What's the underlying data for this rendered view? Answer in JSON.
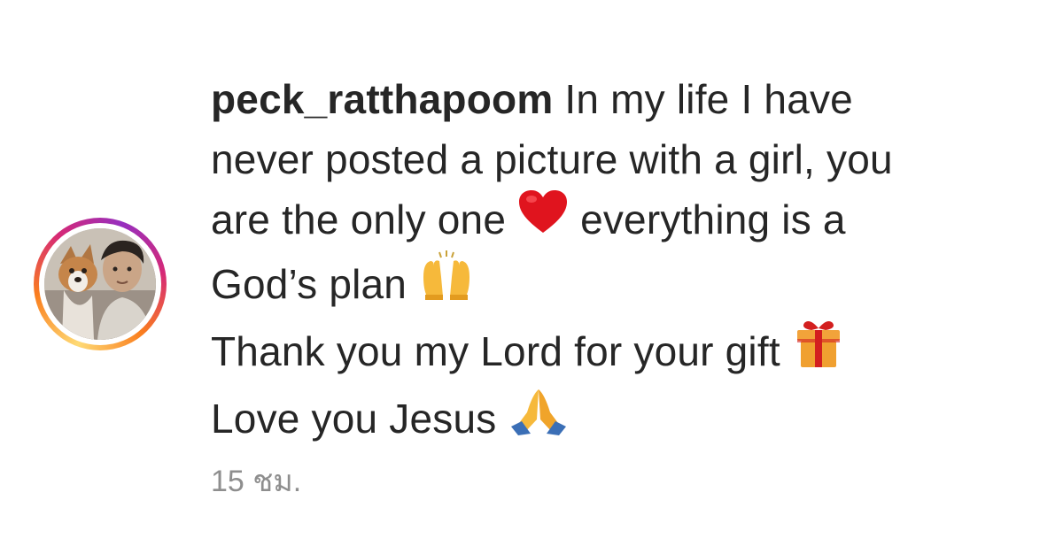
{
  "comment": {
    "username": "peck_ratthapoom",
    "line1_text": "In my life I have",
    "line2_text": "never posted a picture with a girl, you",
    "line3_text_before": "are the only one",
    "line3_text_after": "everything is a",
    "line4_text": "God’s plan",
    "line5_text": "Thank you my Lord for your gift",
    "line6_text": "Love you Jesus",
    "emojis": {
      "heart": "red-heart-icon",
      "raised_hands": "raising-hands-icon",
      "gift": "wrapped-gift-icon",
      "folded_hands": "folded-hands-icon"
    }
  },
  "timestamp": "15 ชม.",
  "colors": {
    "text": "#262626",
    "secondary_text": "#8e8e8e",
    "heart": "#e0141e",
    "story_ring": [
      "#feda75",
      "#fa7e1e",
      "#d62976",
      "#962fbf"
    ]
  },
  "avatar": {
    "name": "profile-avatar"
  }
}
